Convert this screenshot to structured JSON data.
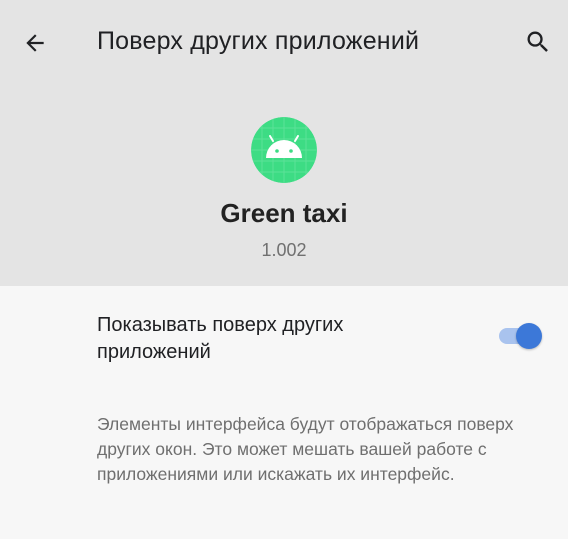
{
  "toolbar": {
    "back_icon": "arrow-back-icon",
    "title": "Поверх других приложений",
    "search_icon": "search-icon"
  },
  "app": {
    "icon": "android-robot-icon",
    "icon_color": "#3ddc84",
    "name": "Green taxi",
    "version": "1.002"
  },
  "setting": {
    "label": "Показывать поверх других приложений",
    "enabled": true,
    "accent_color": "#3c78d8"
  },
  "description": "Элементы интерфейса будут отображаться поверх других окон. Это может мешать вашей работе с приложениями или искажать их интерфейс."
}
